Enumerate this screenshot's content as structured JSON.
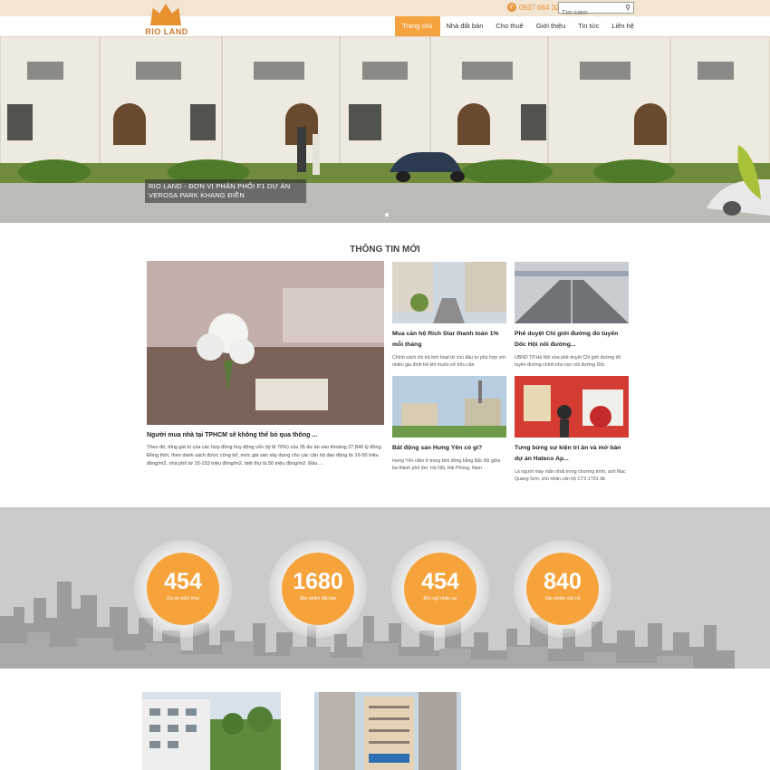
{
  "header": {
    "logo_text": "RIO LAND",
    "phone": "0937 664 321",
    "search_placeholder": "Tìm kiếm",
    "nav": [
      {
        "label": "Trang chủ",
        "active": true
      },
      {
        "label": "Nhà đất bán",
        "active": false
      },
      {
        "label": "Cho thuê",
        "active": false
      },
      {
        "label": "Giới thiệu",
        "active": false
      },
      {
        "label": "Tin tức",
        "active": false
      },
      {
        "label": "Liên hệ",
        "active": false
      }
    ]
  },
  "hero": {
    "caption": "RIO LAND - ĐƠN VỊ PHÂN PHỐI F1 DỰ ÁN VEROSA PARK KHANG ĐIỀN"
  },
  "news": {
    "section_title": "THÔNG TIN MỚI",
    "featured": {
      "title": "Người mua nhà tại TPHCM sẽ không thể bỏ qua thông ...",
      "description": "Theo đó, tổng giá trị của các hợp đồng huy động vốn (tỷ lệ 70%) của 35 dự án vào khoảng 27,840 tỷ đồng. Đồng thời, theo danh sách được công bố, mức giá sàn xây dựng cho các căn hộ dao động từ 16-50 triệu đồng/m2, nhà phố từ 15-153 triệu đồng/m2, biệt thự là 50 triệu đồng/m2. Đầu ..."
    },
    "items": [
      {
        "title": "Mua căn hộ Rich Star thanh toán 1% mỗi tháng",
        "description": "Chính sách chi trả linh hoạt từ chủ đầu tư phù hợp với nhiều gia đình trẻ khi muốn sở hữu căn"
      },
      {
        "title": "Phê duyệt Chỉ giới đường đỏ tuyến Dốc Hội nối đường...",
        "description": "UBND TP.Hà Nội vừa phê duyệt Chỉ giới đường đỏ tuyến đường chính khu vực nối đường Dốc"
      },
      {
        "title": "Bất động sản Hưng Yên có gì?",
        "description": "Hưng Yên nằm ở trung tâm đồng bằng Bắc Bộ giữa ba thành phố lớn: Hà Nội, Hải Phòng, Nam"
      },
      {
        "title": "Tưng bừng sự kiện tri ân và mở bán dự án Hateco Ap...",
        "description": "Là người may mắn nhất trong chương trình, anh Mạc Quang Sơn, chủ nhân căn hộ CT2-1701 đã"
      }
    ]
  },
  "stats": [
    {
      "number": "454",
      "label": "Dự án triển khai"
    },
    {
      "number": "1680",
      "label": "Sản phẩm đặt bán"
    },
    {
      "number": "454",
      "label": "Đội ngũ nhân sự"
    },
    {
      "number": "840",
      "label": "Sản phẩm căn hộ"
    }
  ],
  "colors": {
    "accent": "#f5a33f",
    "topbar": "#f2e6d3",
    "stats_bg": "#cdcdcd"
  }
}
